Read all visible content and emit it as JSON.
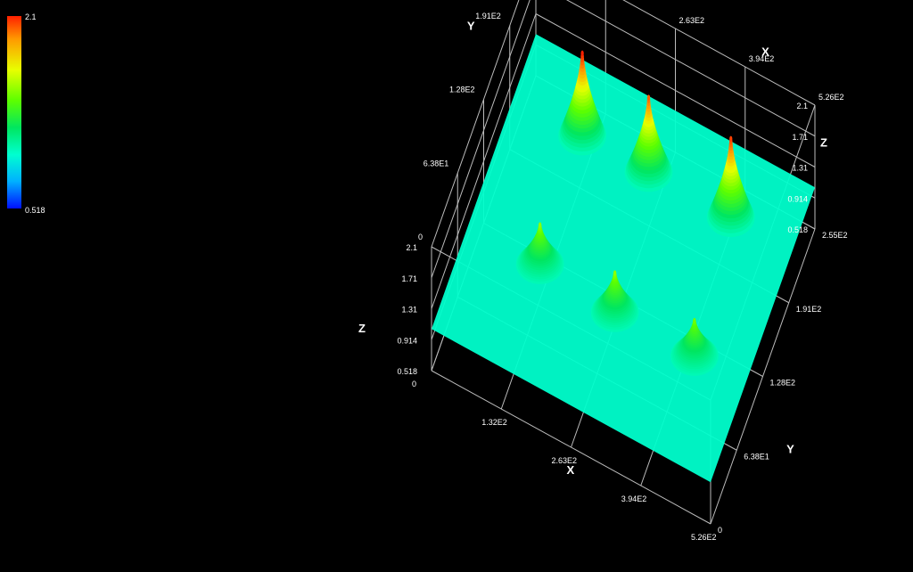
{
  "colorbar": {
    "max_label": "2.1",
    "min_label": "0.518",
    "colors": [
      "#ff2000",
      "#ffff00",
      "#00ff00",
      "#00ffd0",
      "#0010ff"
    ]
  },
  "chart_data": {
    "type": "surface3d",
    "title": "",
    "xlabel": "X",
    "ylabel": "Y",
    "zlabel": "Z",
    "xlim": [
      0,
      526
    ],
    "ylim": [
      0,
      255
    ],
    "zlim": [
      0.518,
      2.1
    ],
    "x_ticks": [
      "0",
      "1.32E2",
      "2.63E2",
      "3.94E2",
      "5.26E2"
    ],
    "y_ticks": [
      "0",
      "6.38E1",
      "1.28E2",
      "1.91E2",
      "2.55E2"
    ],
    "z_ticks": [
      "0.518",
      "0.914",
      "1.31",
      "1.71",
      "2.1"
    ],
    "baseline_z": 1.05,
    "peaks": [
      {
        "x": 130,
        "y": 200,
        "z": 2.1
      },
      {
        "x": 255,
        "y": 200,
        "z": 2.0
      },
      {
        "x": 410,
        "y": 200,
        "z": 2.05
      },
      {
        "x": 135,
        "y": 90,
        "z": 1.55
      },
      {
        "x": 280,
        "y": 85,
        "z": 1.55
      },
      {
        "x": 430,
        "y": 85,
        "z": 1.5
      }
    ]
  }
}
